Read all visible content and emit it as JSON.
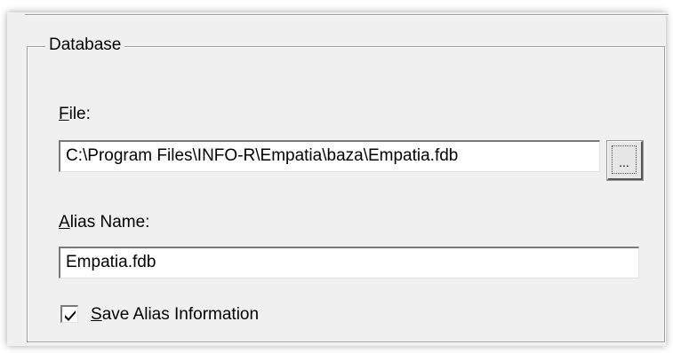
{
  "group": {
    "title": "Database"
  },
  "file": {
    "label_accel": "F",
    "label_rest": "ile:",
    "value": "C:\\Program Files\\INFO-R\\Empatia\\baza\\Empatia.fdb",
    "browse_label": "..."
  },
  "alias": {
    "label_accel": "A",
    "label_rest": "lias Name:",
    "value": "Empatia.fdb"
  },
  "save_alias": {
    "label_accel": "S",
    "label_rest": "ave Alias Information",
    "checked": true
  },
  "icons": {
    "checkbox": "checkmark-icon"
  }
}
